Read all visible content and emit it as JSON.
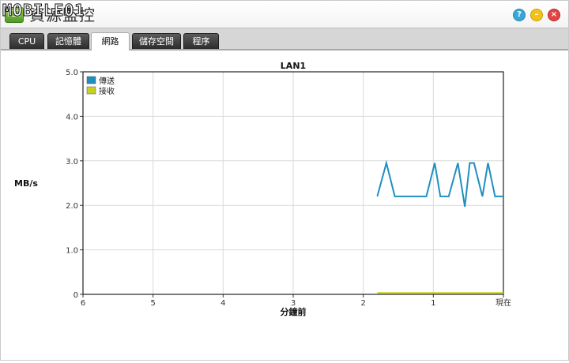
{
  "window": {
    "title": "資源監控",
    "watermark": "MOBILE01",
    "buttons": {
      "help": "?",
      "minimize": "–",
      "close": "×"
    }
  },
  "tabs": [
    {
      "label": "CPU",
      "active": false
    },
    {
      "label": "記憶體",
      "active": false
    },
    {
      "label": "網路",
      "active": true
    },
    {
      "label": "儲存空間",
      "active": false
    },
    {
      "label": "程序",
      "active": false
    }
  ],
  "chart_data": {
    "type": "line",
    "title": "LAN1",
    "ylabel": "MB/s",
    "xlabel": "分鐘前",
    "ylim": [
      0,
      5
    ],
    "xlim": [
      6,
      0
    ],
    "y_ticks": [
      "0",
      "1.0",
      "2.0",
      "3.0",
      "4.0",
      "5.0"
    ],
    "x_ticks": [
      "6",
      "5",
      "4",
      "3",
      "2",
      "1",
      "現在"
    ],
    "grid": true,
    "legend_position": "top-left",
    "series": [
      {
        "name": "傳送",
        "color": "#1f8fc0",
        "x": [
          1.8,
          1.67,
          1.55,
          1.4,
          1.2,
          1.1,
          0.98,
          0.9,
          0.78,
          0.65,
          0.55,
          0.48,
          0.42,
          0.3,
          0.22,
          0.12,
          0.03,
          0.0
        ],
        "y": [
          2.2,
          2.95,
          2.2,
          2.2,
          2.2,
          2.2,
          2.95,
          2.2,
          2.2,
          2.95,
          1.97,
          2.95,
          2.95,
          2.2,
          2.95,
          2.2,
          2.2,
          2.2
        ]
      },
      {
        "name": "接收",
        "color": "#c8d21e",
        "x": [
          1.8,
          1.4,
          1.0,
          0.6,
          0.2,
          0.0
        ],
        "y": [
          0.03,
          0.03,
          0.03,
          0.03,
          0.03,
          0.03
        ]
      }
    ]
  }
}
